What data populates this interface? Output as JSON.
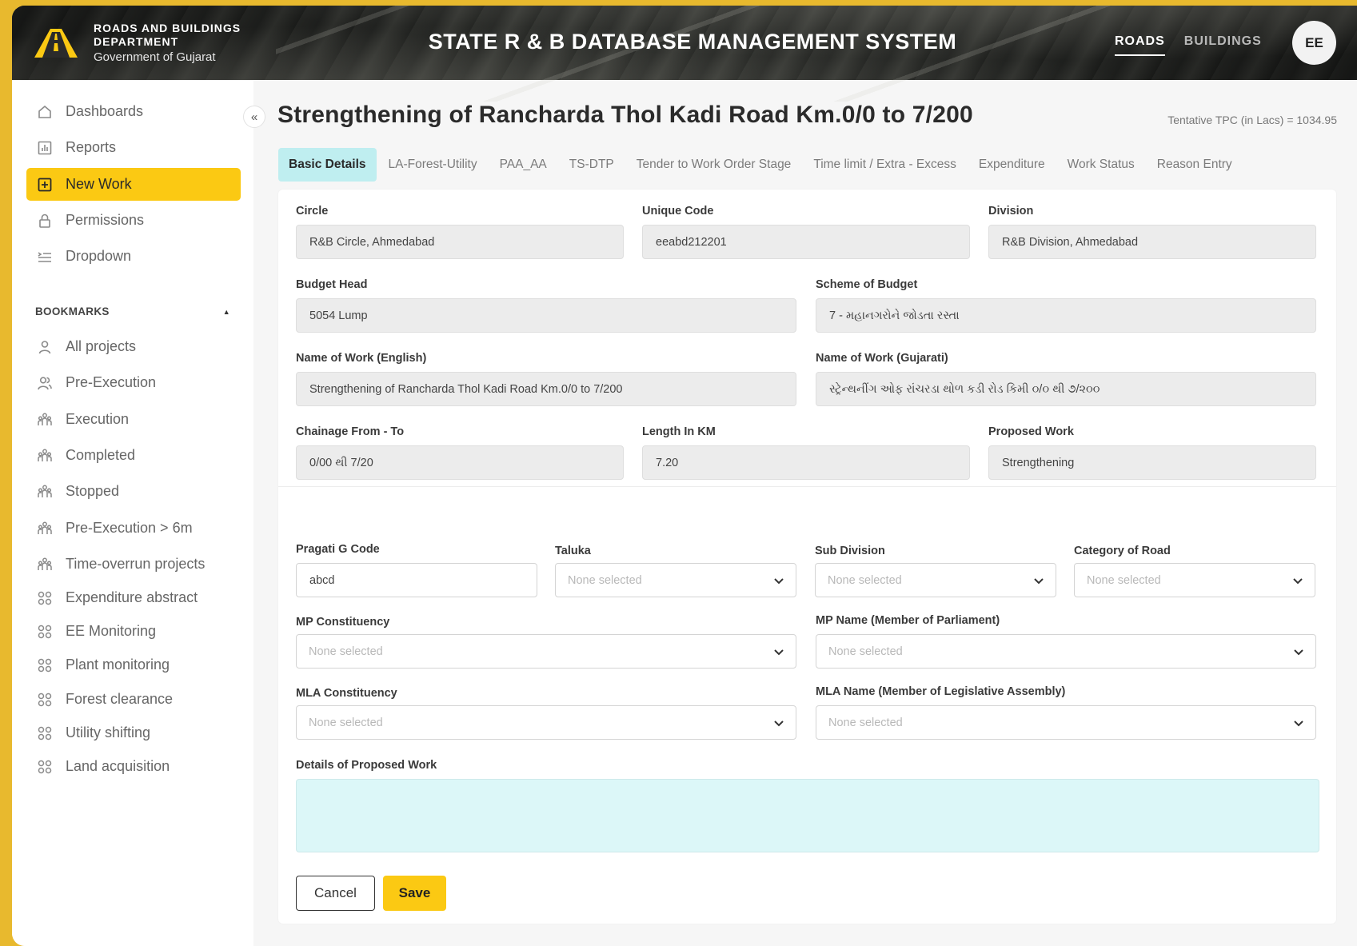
{
  "header": {
    "org_line1": "ROADS AND BUILDINGS",
    "org_line2": "DEPARTMENT",
    "org_line3": "Government of Gujarat",
    "system_title": "STATE R & B DATABASE MANAGEMENT SYSTEM",
    "nav": [
      {
        "label": "ROADS",
        "active": true
      },
      {
        "label": "BUILDINGS",
        "active": false
      }
    ],
    "avatar": "EE"
  },
  "sidebar": {
    "items": [
      {
        "label": "Dashboards",
        "icon": "home-icon"
      },
      {
        "label": "Reports",
        "icon": "bar-chart-icon"
      },
      {
        "label": "New Work",
        "icon": "plus-square-icon",
        "active": true
      },
      {
        "label": "Permissions",
        "icon": "lock-icon"
      },
      {
        "label": "Dropdown",
        "icon": "list-icon"
      }
    ],
    "bookmarks_title": "BOOKMARKS",
    "bookmarks": [
      {
        "label": "All projects",
        "icon": "user-icon"
      },
      {
        "label": "Pre-Execution",
        "icon": "users-icon"
      },
      {
        "label": "Execution",
        "icon": "group-icon"
      },
      {
        "label": "Completed",
        "icon": "group-icon"
      },
      {
        "label": "Stopped",
        "icon": "group-icon"
      },
      {
        "label": "Pre-Execution > 6m",
        "icon": "group-icon"
      },
      {
        "label": "Time-overrun projects",
        "icon": "group-icon"
      },
      {
        "label": "Expenditure abstract",
        "icon": "grid-icon"
      },
      {
        "label": "EE Monitoring",
        "icon": "grid-icon"
      },
      {
        "label": "Plant monitoring",
        "icon": "grid-icon"
      },
      {
        "label": "Forest clearance",
        "icon": "grid-icon"
      },
      {
        "label": "Utility shifting",
        "icon": "grid-icon"
      },
      {
        "label": "Land acquisition",
        "icon": "grid-icon"
      }
    ]
  },
  "page": {
    "title": "Strengthening of Rancharda Thol Kadi Road Km.0/0 to 7/200",
    "tpc": "Tentative TPC (in Lacs) = 1034.95",
    "tabs": [
      "Basic Details",
      "LA-Forest-Utility",
      "PAA_AA",
      "TS-DTP",
      "Tender to Work Order Stage",
      "Time limit / Extra - Excess",
      "Expenditure",
      "Work Status",
      "Reason Entry"
    ],
    "active_tab": "Basic Details"
  },
  "form": {
    "circle": {
      "label": "Circle",
      "value": "R&B Circle, Ahmedabad"
    },
    "unique_code": {
      "label": "Unique Code",
      "value": "eeabd212201"
    },
    "division": {
      "label": "Division",
      "value": "R&B Division, Ahmedabad"
    },
    "budget_head": {
      "label": "Budget Head",
      "value": "5054 Lump"
    },
    "scheme_of_budget": {
      "label": "Scheme of Budget",
      "value": "7 - મહાનગરોને જોડતા રસ્તા"
    },
    "name_english": {
      "label": "Name of Work (English)",
      "value": "Strengthening of Rancharda Thol Kadi Road Km.0/0 to 7/200"
    },
    "name_gujarati": {
      "label": "Name of Work (Gujarati)",
      "value": "સ્ટ્રેન્થનીંગ ઓફ રાંચરડા થોળ કડી રોડ કિમી ૦/૦ થી ૭/૨૦૦"
    },
    "chainage": {
      "label": "Chainage From - To",
      "value": "0/00 થી 7/20"
    },
    "length_km": {
      "label": "Length In KM",
      "value": "7.20"
    },
    "proposed_work": {
      "label": "Proposed Work",
      "value": "Strengthening"
    },
    "pragati_code": {
      "label": "Pragati G Code",
      "value": "abcd"
    },
    "taluka": {
      "label": "Taluka",
      "value": "None selected"
    },
    "sub_division": {
      "label": "Sub Division",
      "value": "None selected"
    },
    "category_of_road": {
      "label": "Category of Road",
      "value": "None selected"
    },
    "mp_constituency": {
      "label": "MP Constituency",
      "value": "None selected"
    },
    "mp_name": {
      "label": "MP Name (Member of Parliament)",
      "value": "None selected"
    },
    "mla_constituency": {
      "label": "MLA Constituency",
      "value": "None selected"
    },
    "mla_name": {
      "label": "MLA Name (Member of Legislative Assembly)",
      "value": "None selected"
    },
    "details": {
      "label": "Details of Proposed Work",
      "value": ""
    },
    "cancel_label": "Cancel",
    "save_label": "Save"
  },
  "colors": {
    "accent": "#fbc913",
    "active_tab": "#bfeef0",
    "textarea_bg": "#dcf7f8",
    "frame": "#e8b92e"
  }
}
